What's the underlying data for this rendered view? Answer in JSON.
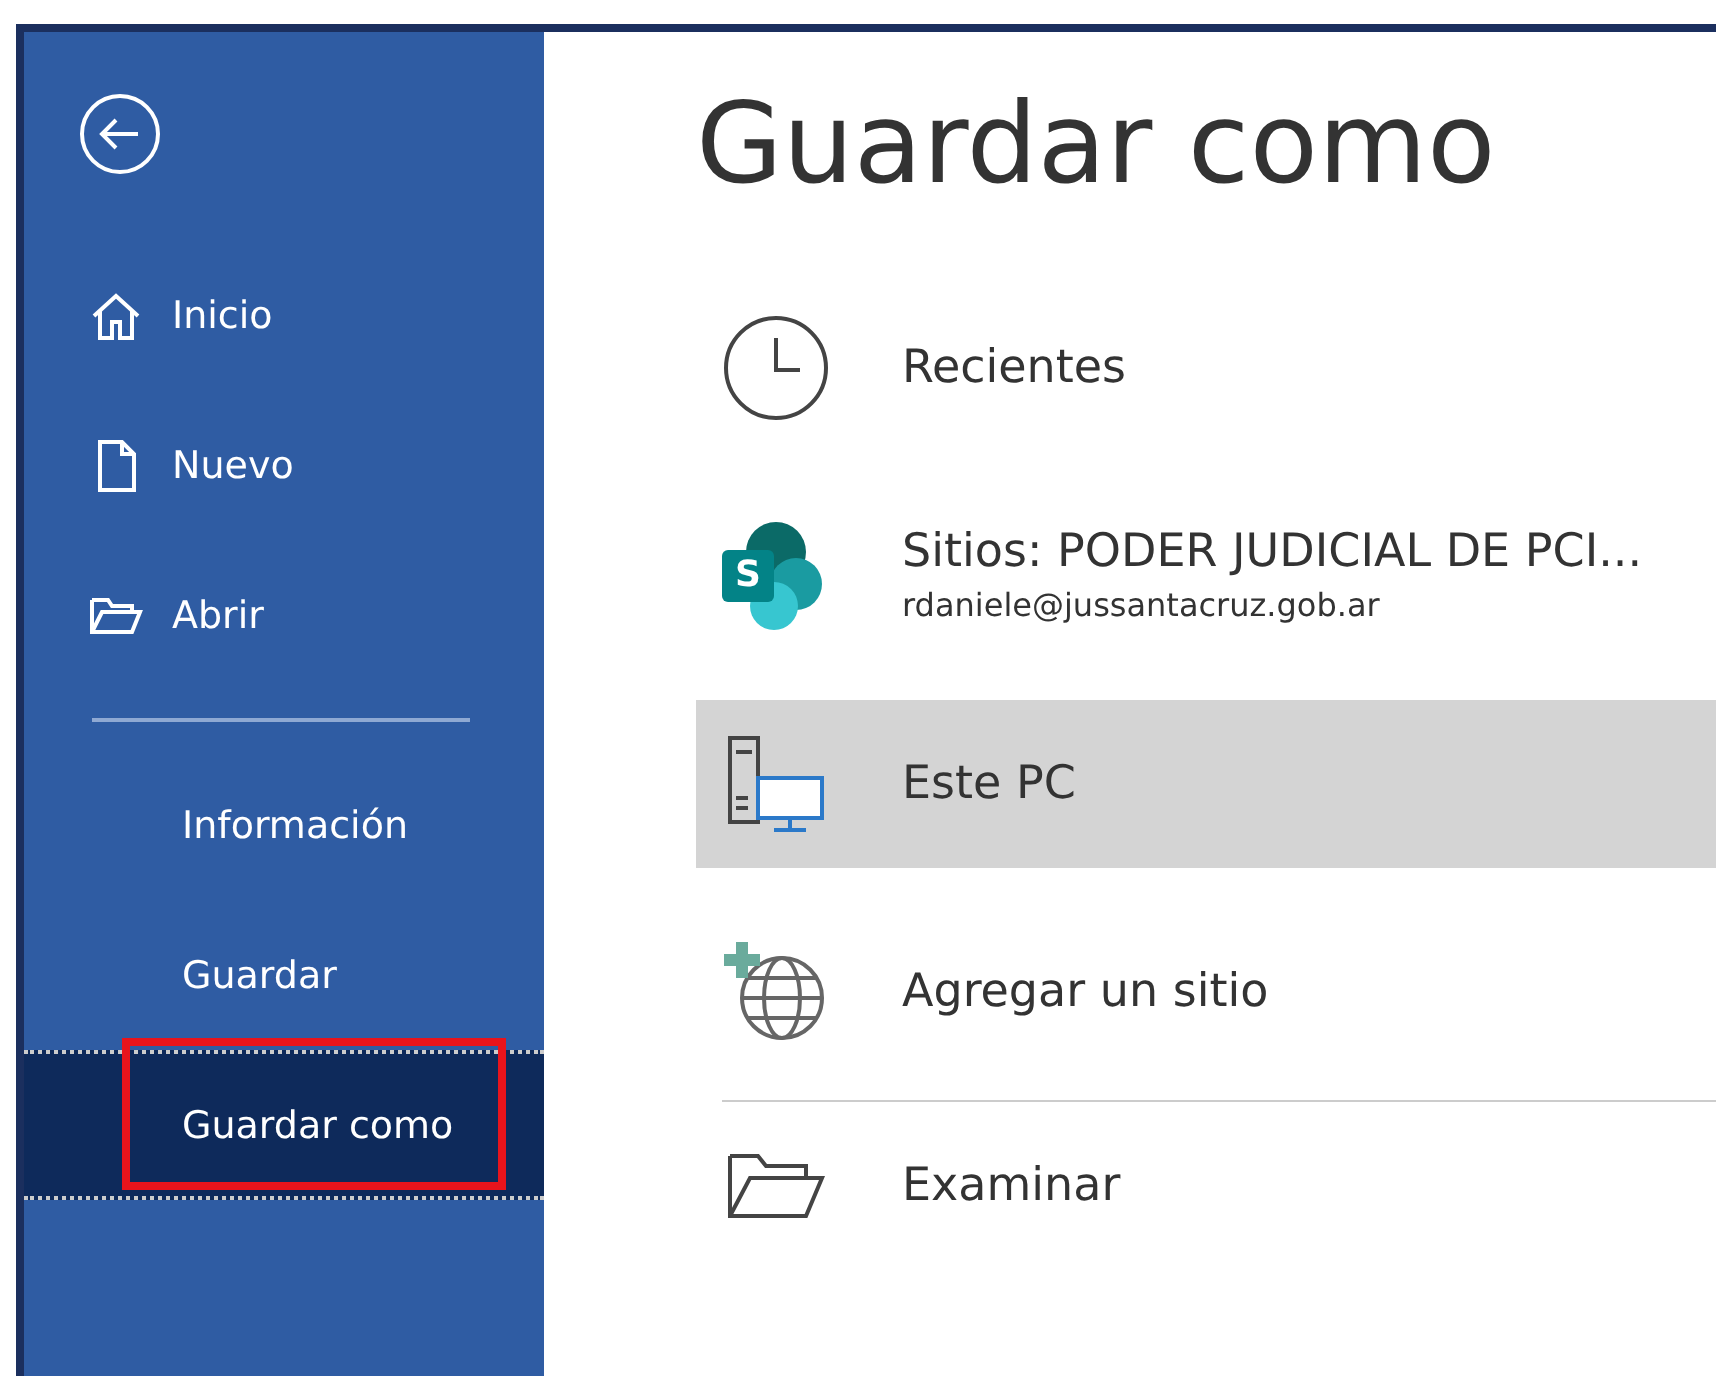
{
  "page_title": "Guardar como",
  "sidebar": {
    "primary_items": [
      {
        "label": "Inicio",
        "selected": false,
        "highlighted": false
      },
      {
        "label": "Nuevo",
        "selected": false,
        "highlighted": false
      },
      {
        "label": "Abrir",
        "selected": false,
        "highlighted": false
      }
    ],
    "secondary_items": [
      {
        "label": "Información",
        "selected": false,
        "highlighted": false
      },
      {
        "label": "Guardar",
        "selected": false,
        "highlighted": false
      },
      {
        "label": "Guardar como",
        "selected": true,
        "highlighted": true
      }
    ]
  },
  "locations": [
    {
      "title": "Recientes",
      "selected": false,
      "separated": false
    },
    {
      "title": "Sitios: PODER JUDICIAL DE PCI...",
      "subtitle": "rdaniele@jussantacruz.gob.ar",
      "badge": "S",
      "selected": false,
      "separated": false
    },
    {
      "title": "Este PC",
      "selected": true,
      "separated": false
    },
    {
      "title": "Agregar un sitio",
      "selected": false,
      "separated": false
    },
    {
      "title": "Examinar",
      "selected": false,
      "separated": true
    }
  ]
}
